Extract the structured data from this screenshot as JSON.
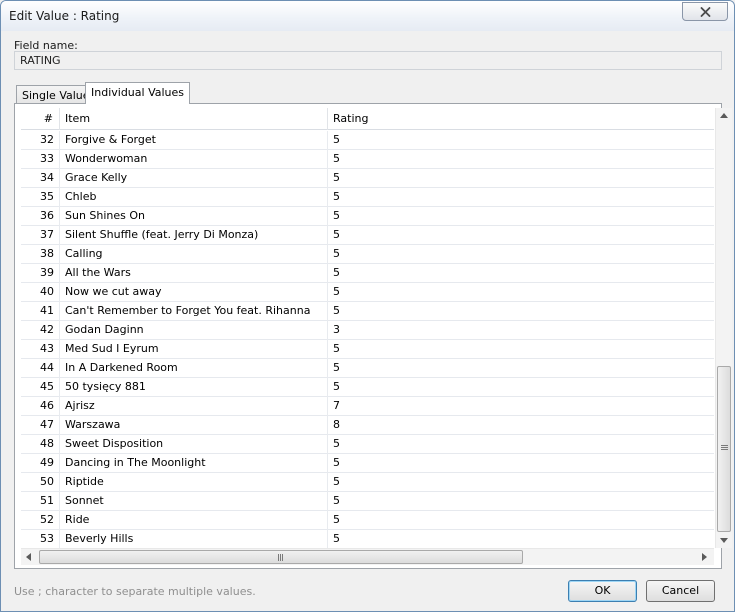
{
  "window": {
    "title": "Edit Value : Rating"
  },
  "field": {
    "label": "Field name:",
    "value": "RATING"
  },
  "tabs": [
    {
      "label": "Single Value",
      "active": false
    },
    {
      "label": "Individual Values",
      "active": true
    }
  ],
  "table": {
    "columns": [
      "#",
      "Item",
      "Rating"
    ],
    "rows": [
      {
        "num": "32",
        "item": "Forgive & Forget",
        "rating": "5"
      },
      {
        "num": "33",
        "item": "Wonderwoman",
        "rating": "5"
      },
      {
        "num": "34",
        "item": "Grace Kelly",
        "rating": "5"
      },
      {
        "num": "35",
        "item": "Chleb",
        "rating": "5"
      },
      {
        "num": "36",
        "item": "Sun Shines On",
        "rating": "5"
      },
      {
        "num": "37",
        "item": "Silent Shuffle (feat. Jerry Di Monza)",
        "rating": "5"
      },
      {
        "num": "38",
        "item": "Calling",
        "rating": "5"
      },
      {
        "num": "39",
        "item": "All the Wars",
        "rating": "5"
      },
      {
        "num": "40",
        "item": "Now we cut away",
        "rating": "5"
      },
      {
        "num": "41",
        "item": "Can't Remember to Forget You feat. Rihanna",
        "rating": "5"
      },
      {
        "num": "42",
        "item": "Godan Daginn",
        "rating": "3"
      },
      {
        "num": "43",
        "item": "Med Sud I Eyrum",
        "rating": "5"
      },
      {
        "num": "44",
        "item": "In A Darkened Room",
        "rating": "5"
      },
      {
        "num": "45",
        "item": "50 tysięcy 881",
        "rating": "5"
      },
      {
        "num": "46",
        "item": "Ajrisz",
        "rating": "7"
      },
      {
        "num": "47",
        "item": "Warszawa",
        "rating": "8"
      },
      {
        "num": "48",
        "item": "Sweet Disposition",
        "rating": "5"
      },
      {
        "num": "49",
        "item": "Dancing in The Moonlight",
        "rating": "5"
      },
      {
        "num": "50",
        "item": "Riptide",
        "rating": "5"
      },
      {
        "num": "51",
        "item": "Sonnet",
        "rating": "5"
      },
      {
        "num": "52",
        "item": "Ride",
        "rating": "5"
      },
      {
        "num": "53",
        "item": "Beverly Hills",
        "rating": "5"
      }
    ]
  },
  "footer": {
    "hint": "Use ; character to separate multiple values.",
    "ok_label": "OK",
    "cancel_label": "Cancel"
  },
  "icons": {
    "close": "close-icon",
    "scroll_up": "arrow-up-icon",
    "scroll_down": "arrow-down-icon",
    "scroll_left": "arrow-left-icon",
    "scroll_right": "arrow-right-icon"
  }
}
